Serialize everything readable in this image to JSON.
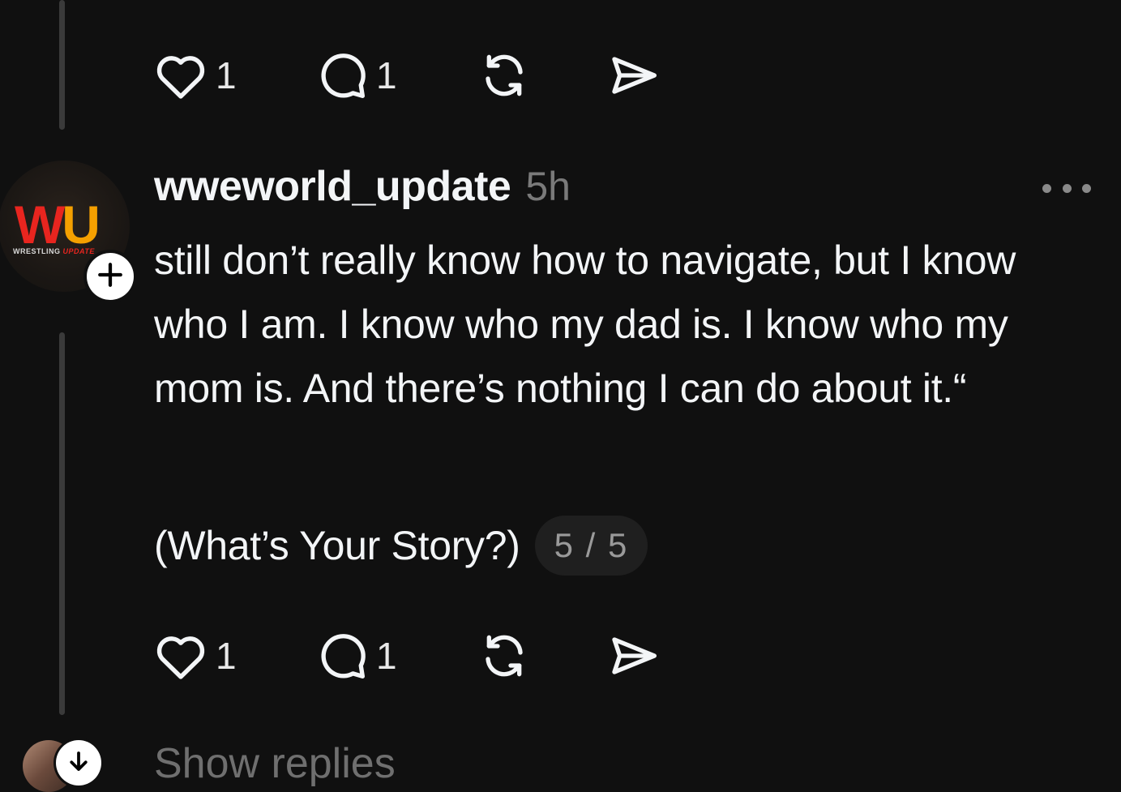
{
  "previous_post": {
    "actions": {
      "like_count": "1",
      "reply_count": "1"
    }
  },
  "post": {
    "username": "wweworld_update",
    "timestamp": "5h",
    "avatar": {
      "logo_text_w": "W",
      "logo_text_u": "U",
      "logo_sub_1": "WRESTLING ",
      "logo_sub_2": "UPDATE"
    },
    "body": "still don’t really know how to navigate, but I know who I am. I know who my dad is. I know who my mom is. And there’s nothing I can do about it.“",
    "story_link": "(What’s Your Story?)",
    "page_indicator": "5 / 5",
    "actions": {
      "like_count": "1",
      "reply_count": "1"
    }
  },
  "show_replies_label": "Show replies",
  "icons": {
    "like": "heart-icon",
    "reply": "comment-icon",
    "repost": "repost-icon",
    "share": "send-icon",
    "more": "more-horizontal-icon",
    "follow": "plus-icon",
    "expand": "arrow-down-icon"
  },
  "colors": {
    "background": "#101010",
    "text_primary": "#f3f5f7",
    "text_secondary": "#7a7a7a",
    "thread_line": "#3a3a3a",
    "logo_red": "#e8251f",
    "logo_orange": "#f5a000"
  }
}
